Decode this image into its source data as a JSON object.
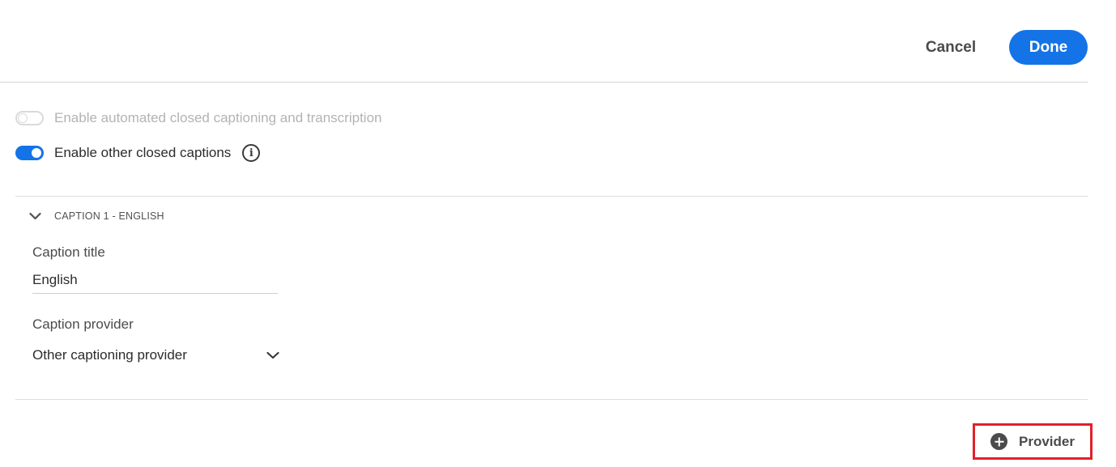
{
  "header": {
    "cancel_label": "Cancel",
    "done_label": "Done",
    "accent_color": "#1473e6"
  },
  "toggles": {
    "automated": {
      "label": "Enable automated closed captioning and transcription",
      "state": "off",
      "disabled": true
    },
    "other": {
      "label": "Enable other closed captions",
      "state": "on",
      "info_icon": "info-icon"
    }
  },
  "caption": {
    "header_label": "CAPTION 1 - ENGLISH",
    "expanded": true,
    "title_label": "Caption title",
    "title_value": "English",
    "provider_label": "Caption provider",
    "provider_value": "Other captioning provider"
  },
  "footer": {
    "add_provider_label": "Provider",
    "add_icon": "plus-circle-icon",
    "highlight_color": "#e0212b"
  }
}
